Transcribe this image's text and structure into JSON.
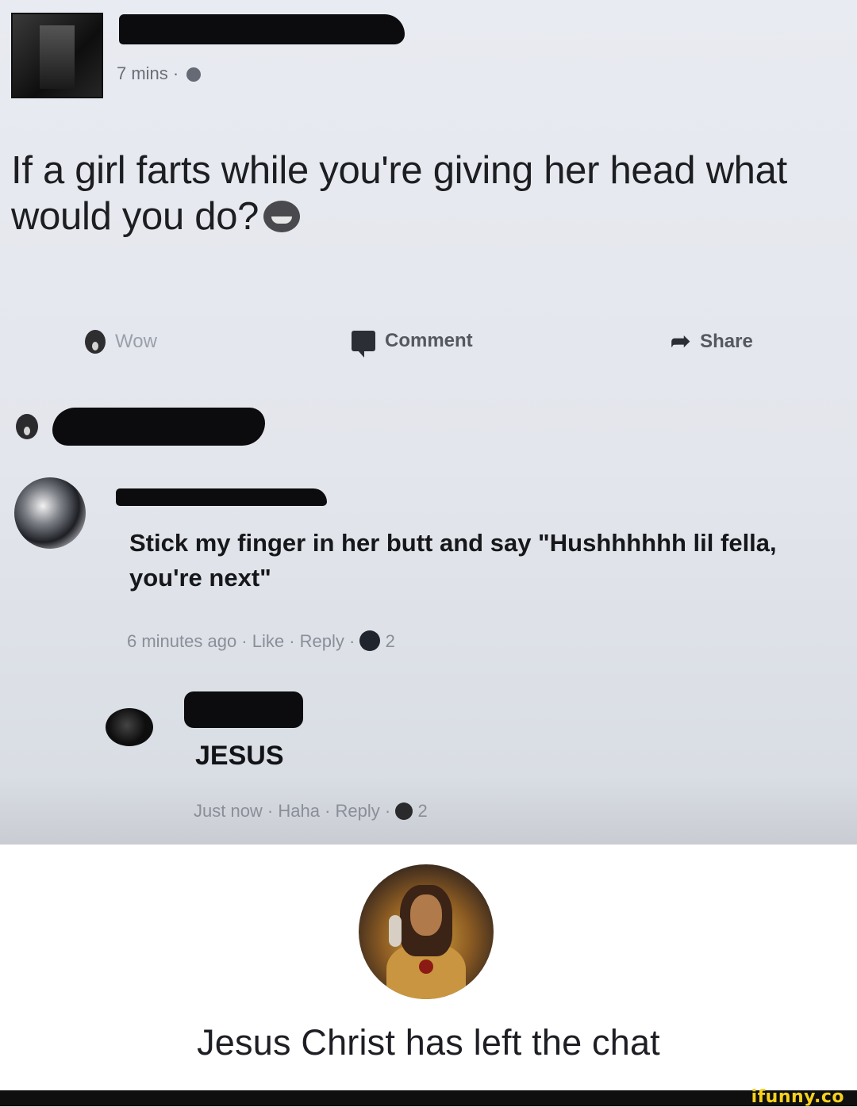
{
  "post": {
    "timestamp": "7 mins ·",
    "text": "If a girl farts while you're giving her head what would you do?",
    "actions": {
      "wow": "Wow",
      "comment": "Comment",
      "share": "Share"
    }
  },
  "comments": [
    {
      "text": "Stick my finger in her butt and say \"Hushhhhhh lil fella, you're next\"",
      "meta": "6 minutes ago · Like · Reply ·",
      "reaction_count": "2"
    },
    {
      "text": "JESUS",
      "meta": "Just now · Haha · Reply ·",
      "reaction_count": "2"
    }
  ],
  "bottom": {
    "caption": "Jesus Christ has left the chat"
  },
  "watermark": "ifunny.co"
}
